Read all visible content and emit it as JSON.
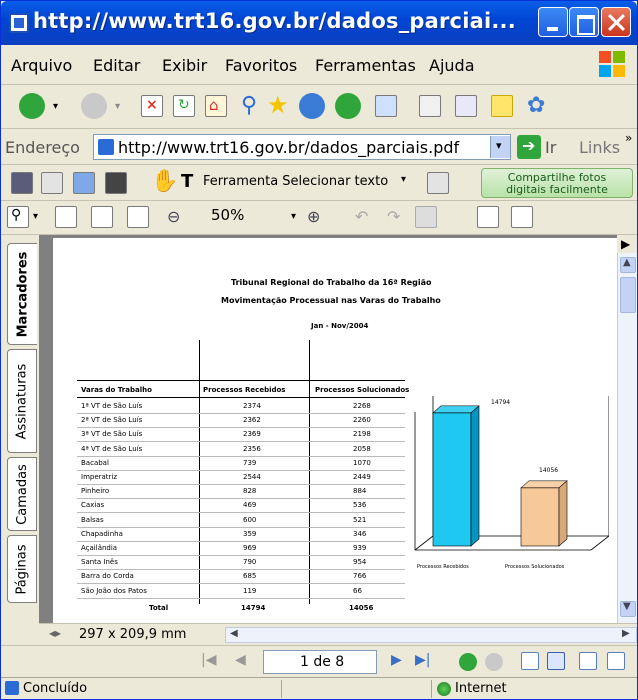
{
  "window": {
    "title": "http://www.trt16.gov.br/dados_parciai..."
  },
  "menu": {
    "items": [
      "Arquivo",
      "Editar",
      "Exibir",
      "Favoritos",
      "Ferramentas",
      "Ajuda"
    ]
  },
  "address": {
    "label": "Endereço",
    "url": "http://www.trt16.gov.br/dados_parciais.pdf",
    "go_label": "Ir",
    "links_label": "Links"
  },
  "acrobat": {
    "select_tool_label": "Ferramenta Selecionar texto",
    "promo_line1": "Compartilhe fotos",
    "promo_line2": "digitais facilmente",
    "zoom": "50%"
  },
  "sidetabs": [
    "Marcadores",
    "Assinaturas",
    "Camadas",
    "Páginas"
  ],
  "document": {
    "title1": "Tribunal Regional do Trabalho da 16ª Região",
    "title2": "Movimentação Processual nas Varas do Trabalho",
    "period": "Jan - Nov/2004",
    "table": {
      "headers": [
        "Varas do Trabalho",
        "Processos Recebidos",
        "Processos Solucionados"
      ],
      "rows": [
        [
          "1ª VT de São Luís",
          "2374",
          "2268"
        ],
        [
          "2ª VT de São Luís",
          "2362",
          "2260"
        ],
        [
          "3ª VT de São Luís",
          "2369",
          "2198"
        ],
        [
          "4ª VT de São Luís",
          "2356",
          "2058"
        ],
        [
          "Bacabal",
          "739",
          "1070"
        ],
        [
          "Imperatriz",
          "2544",
          "2449"
        ],
        [
          "Pinheiro",
          "828",
          "884"
        ],
        [
          "Caxias",
          "469",
          "536"
        ],
        [
          "Balsas",
          "600",
          "521"
        ],
        [
          "Chapadinha",
          "359",
          "346"
        ],
        [
          "Açailândia",
          "969",
          "939"
        ],
        [
          "Santa Inês",
          "790",
          "954"
        ],
        [
          "Barra do Corda",
          "685",
          "766"
        ],
        [
          "São João dos Patos",
          "119",
          "66"
        ]
      ],
      "total_label": "Total",
      "total_received": "14794",
      "total_solved": "14056"
    }
  },
  "chart_data": {
    "type": "bar",
    "categories": [
      "Processos Recebidos",
      "Processos Solucionados"
    ],
    "values": [
      14794,
      14056
    ],
    "data_labels": [
      "14794",
      "14056"
    ],
    "colors": [
      "#1fc8f0",
      "#f7c999"
    ],
    "title": "",
    "xlabel": "",
    "ylabel": ""
  },
  "statusbar": {
    "page_size": "297 x 209,9 mm",
    "page_nav": "1 de 8",
    "status_left": "Concluído",
    "status_right": "Internet"
  }
}
